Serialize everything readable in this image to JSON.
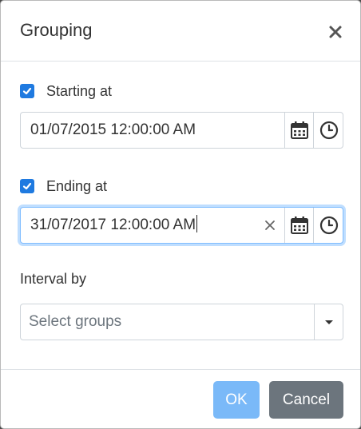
{
  "dialog": {
    "title": "Grouping"
  },
  "starting": {
    "checkbox_label": "Starting at",
    "checked": true,
    "value": "01/07/2015 12:00:00 AM"
  },
  "ending": {
    "checkbox_label": "Ending at",
    "checked": true,
    "value": "31/07/2017 12:00:00 AM"
  },
  "interval": {
    "label": "Interval by",
    "placeholder": "Select groups"
  },
  "footer": {
    "ok_label": "OK",
    "cancel_label": "Cancel"
  },
  "colors": {
    "accent": "#1f7ae0",
    "ok_button": "#7ab9f8",
    "cancel_button": "#6c757d"
  },
  "icons": [
    "close-icon",
    "check-icon",
    "calendar-icon",
    "clock-icon",
    "clear-icon",
    "caret-down-icon"
  ]
}
